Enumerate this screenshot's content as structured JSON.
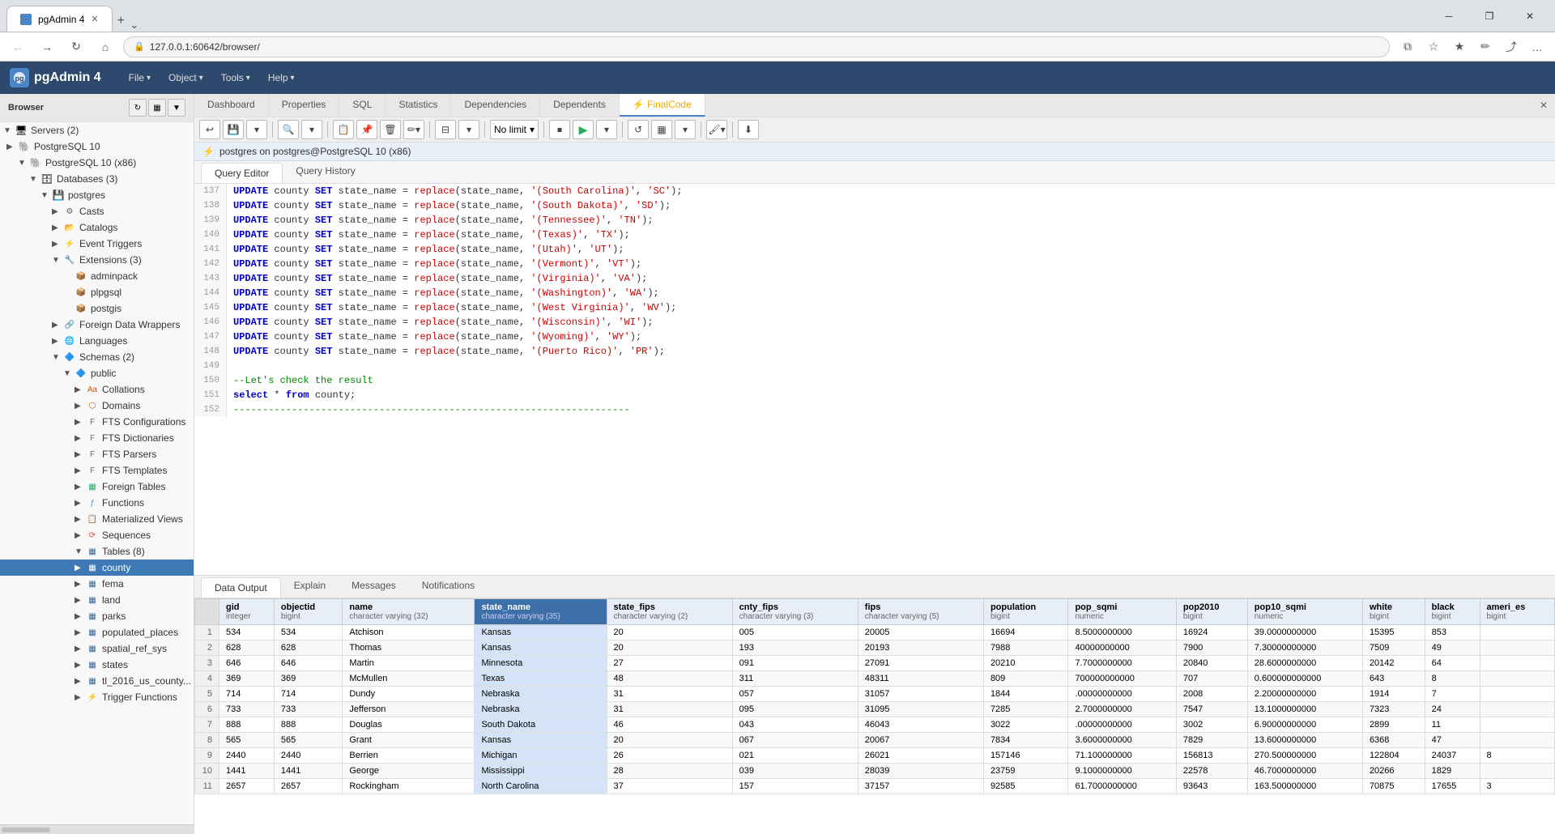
{
  "browser": {
    "tab_label": "pgAdmin 4",
    "url": "127.0.0.1:60642/browser/",
    "url_full": "127.0.0.1:60642/browser/"
  },
  "pgadmin": {
    "title": "pgAdmin 4",
    "menus": [
      "File",
      "Object",
      "Tools",
      "Help"
    ],
    "server_connection": "postgres on postgres@PostgreSQL 10 (x86)"
  },
  "sidebar": {
    "title": "Browser",
    "tree": [
      {
        "id": "servers",
        "label": "Servers (2)",
        "indent": 0,
        "expanded": true,
        "icon": "server"
      },
      {
        "id": "pg10",
        "label": "PostgreSQL 10",
        "indent": 1,
        "expanded": true,
        "icon": "pg"
      },
      {
        "id": "pg10x86",
        "label": "PostgreSQL 10 (x86)",
        "indent": 2,
        "expanded": true,
        "icon": "pg"
      },
      {
        "id": "databases",
        "label": "Databases (3)",
        "indent": 3,
        "expanded": true,
        "icon": "db"
      },
      {
        "id": "postgres",
        "label": "postgres",
        "indent": 4,
        "expanded": true,
        "icon": "db2"
      },
      {
        "id": "casts",
        "label": "Casts",
        "indent": 5,
        "expanded": false,
        "icon": "cast"
      },
      {
        "id": "catalogs",
        "label": "Catalogs",
        "indent": 5,
        "expanded": false,
        "icon": "catalog"
      },
      {
        "id": "event_triggers",
        "label": "Event Triggers",
        "indent": 5,
        "expanded": false,
        "icon": "trigger"
      },
      {
        "id": "extensions",
        "label": "Extensions (3)",
        "indent": 5,
        "expanded": true,
        "icon": "ext"
      },
      {
        "id": "adminpack",
        "label": "adminpack",
        "indent": 6,
        "expanded": false,
        "icon": "ext2"
      },
      {
        "id": "plpgsql",
        "label": "plpgsql",
        "indent": 6,
        "expanded": false,
        "icon": "ext2"
      },
      {
        "id": "postgis",
        "label": "postgis",
        "indent": 6,
        "expanded": false,
        "icon": "ext2"
      },
      {
        "id": "foreign_data",
        "label": "Foreign Data Wrappers",
        "indent": 5,
        "expanded": false,
        "icon": "fdw"
      },
      {
        "id": "languages",
        "label": "Languages",
        "indent": 5,
        "expanded": false,
        "icon": "lang"
      },
      {
        "id": "schemas",
        "label": "Schemas (2)",
        "indent": 5,
        "expanded": true,
        "icon": "schema"
      },
      {
        "id": "public",
        "label": "public",
        "indent": 6,
        "expanded": true,
        "icon": "schema2"
      },
      {
        "id": "collations",
        "label": "Collations",
        "indent": 7,
        "expanded": false,
        "icon": "coll"
      },
      {
        "id": "domains",
        "label": "Domains",
        "indent": 7,
        "expanded": false,
        "icon": "domain"
      },
      {
        "id": "fts_config",
        "label": "FTS Configurations",
        "indent": 7,
        "expanded": false,
        "icon": "fts"
      },
      {
        "id": "fts_dict",
        "label": "FTS Dictionaries",
        "indent": 7,
        "expanded": false,
        "icon": "fts"
      },
      {
        "id": "fts_parsers",
        "label": "FTS Parsers",
        "indent": 7,
        "expanded": false,
        "icon": "fts"
      },
      {
        "id": "fts_templates",
        "label": "FTS Templates",
        "indent": 7,
        "expanded": false,
        "icon": "fts"
      },
      {
        "id": "foreign_tables",
        "label": "Foreign Tables",
        "indent": 7,
        "expanded": false,
        "icon": "ftable"
      },
      {
        "id": "functions",
        "label": "Functions",
        "indent": 7,
        "expanded": false,
        "icon": "func"
      },
      {
        "id": "mat_views",
        "label": "Materialized Views",
        "indent": 7,
        "expanded": false,
        "icon": "matview"
      },
      {
        "id": "sequences",
        "label": "Sequences",
        "indent": 7,
        "expanded": false,
        "icon": "seq"
      },
      {
        "id": "tables",
        "label": "Tables (8)",
        "indent": 7,
        "expanded": true,
        "icon": "tables"
      },
      {
        "id": "county",
        "label": "county",
        "indent": 8,
        "expanded": false,
        "icon": "table",
        "selected": true
      },
      {
        "id": "fema",
        "label": "fema",
        "indent": 8,
        "expanded": false,
        "icon": "table"
      },
      {
        "id": "land",
        "label": "land",
        "indent": 8,
        "expanded": false,
        "icon": "table"
      },
      {
        "id": "parks",
        "label": "parks",
        "indent": 8,
        "expanded": false,
        "icon": "table"
      },
      {
        "id": "populated_places",
        "label": "populated_places",
        "indent": 8,
        "expanded": false,
        "icon": "table"
      },
      {
        "id": "spatial_ref_sys",
        "label": "spatial_ref_sys",
        "indent": 8,
        "expanded": false,
        "icon": "table"
      },
      {
        "id": "states",
        "label": "states",
        "indent": 8,
        "expanded": false,
        "icon": "table"
      },
      {
        "id": "tl2016_us_county",
        "label": "tl_2016_us_county...",
        "indent": 8,
        "expanded": false,
        "icon": "table"
      },
      {
        "id": "trigger_functions",
        "label": "Trigger Functions",
        "indent": 7,
        "expanded": false,
        "icon": "trigfunc"
      }
    ]
  },
  "panel_tabs": [
    "Dashboard",
    "Properties",
    "SQL",
    "Statistics",
    "Dependencies",
    "Dependents",
    "FinalCode"
  ],
  "active_tab": "FinalCode",
  "query_tabs": [
    "Query Editor",
    "Query History"
  ],
  "active_query_tab": "Query Editor",
  "results_tabs": [
    "Data Output",
    "Explain",
    "Messages",
    "Notifications"
  ],
  "active_results_tab": "Data Output",
  "no_limit": "No limit",
  "code_lines": [
    {
      "num": 137,
      "content": "UPDATE county SET state_name = replace(state_name, '(South Carolina)', 'SC');"
    },
    {
      "num": 138,
      "content": "UPDATE county SET state_name = replace(state_name, '(South Dakota)', 'SD');"
    },
    {
      "num": 139,
      "content": "UPDATE county SET state_name = replace(state_name, '(Tennessee)', 'TN');"
    },
    {
      "num": 140,
      "content": "UPDATE county SET state_name = replace(state_name, '(Texas)', 'TX');"
    },
    {
      "num": 141,
      "content": "UPDATE county SET state_name = replace(state_name, '(Utah)', 'UT');"
    },
    {
      "num": 142,
      "content": "UPDATE county SET state_name = replace(state_name, '(Vermont)', 'VT');"
    },
    {
      "num": 143,
      "content": "UPDATE county SET state_name = replace(state_name, '(Virginia)', 'VA');"
    },
    {
      "num": 144,
      "content": "UPDATE county SET state_name = replace(state_name, '(Washington)', 'WA');"
    },
    {
      "num": 145,
      "content": "UPDATE county SET state_name = replace(state_name, '(West Virginia)', 'WV');"
    },
    {
      "num": 146,
      "content": "UPDATE county SET state_name = replace(state_name, '(Wisconsin)', 'WI');"
    },
    {
      "num": 147,
      "content": "UPDATE county SET state_name = replace(state_name, '(Wyoming)', 'WY');"
    },
    {
      "num": 148,
      "content": "UPDATE county SET state_name = replace(state_name, '(Puerto Rico)', 'PR');"
    },
    {
      "num": 149,
      "content": ""
    },
    {
      "num": 150,
      "content": "--Let's check the result"
    },
    {
      "num": 151,
      "content": "select * from county;"
    },
    {
      "num": 152,
      "content": "--------------------------------------------------------------------"
    }
  ],
  "table_columns": [
    {
      "name": "gid",
      "type": "integer"
    },
    {
      "name": "objectid",
      "type": "bigint"
    },
    {
      "name": "name",
      "type": "character varying (32)"
    },
    {
      "name": "state_name",
      "type": "character varying (35)",
      "highlighted": true
    },
    {
      "name": "state_fips",
      "type": "character varying (2)"
    },
    {
      "name": "cnty_fips",
      "type": "character varying (3)"
    },
    {
      "name": "fips",
      "type": "character varying (5)"
    },
    {
      "name": "population",
      "type": "bigint"
    },
    {
      "name": "pop_sqmi",
      "type": "numeric"
    },
    {
      "name": "pop2010",
      "type": "bigint"
    },
    {
      "name": "pop10_sqmi",
      "type": "numeric"
    },
    {
      "name": "white",
      "type": "bigint"
    },
    {
      "name": "black",
      "type": "bigint"
    },
    {
      "name": "ameri_es",
      "type": "bigint"
    }
  ],
  "table_rows": [
    {
      "row": 1,
      "gid": 534,
      "objectid": 534,
      "name": "Atchison",
      "state_name": "Kansas",
      "state_fips": "20",
      "cnty_fips": "005",
      "fips": "20005",
      "population": 16694,
      "pop_sqmi": "8.5000000000",
      "pop2010": 16924,
      "pop10_sqmi": "39.0000000000",
      "white": 15395,
      "black": 853,
      "ameri_es": ""
    },
    {
      "row": 2,
      "gid": 628,
      "objectid": 628,
      "name": "Thomas",
      "state_name": "Kansas",
      "state_fips": "20",
      "cnty_fips": "193",
      "fips": "20193",
      "population": 7988,
      "pop_sqmi": "40000000000",
      "pop2010": 7900,
      "pop10_sqmi": "7.30000000000",
      "white": 7509,
      "black": 49,
      "ameri_es": ""
    },
    {
      "row": 3,
      "gid": 646,
      "objectid": 646,
      "name": "Martin",
      "state_name": "Minnesota",
      "state_fips": "27",
      "cnty_fips": "091",
      "fips": "27091",
      "population": 20210,
      "pop_sqmi": "7.7000000000",
      "pop2010": 20840,
      "pop10_sqmi": "28.6000000000",
      "white": 20142,
      "black": 64,
      "ameri_es": ""
    },
    {
      "row": 4,
      "gid": 369,
      "objectid": 369,
      "name": "McMullen",
      "state_name": "Texas",
      "state_fips": "48",
      "cnty_fips": "311",
      "fips": "48311",
      "population": 809,
      "pop_sqmi": "700000000000",
      "pop2010": 707,
      "pop10_sqmi": "0.600000000000",
      "white": 643,
      "black": 8,
      "ameri_es": ""
    },
    {
      "row": 5,
      "gid": 714,
      "objectid": 714,
      "name": "Dundy",
      "state_name": "Nebraska",
      "state_fips": "31",
      "cnty_fips": "057",
      "fips": "31057",
      "population": 1844,
      "pop_sqmi": ".00000000000",
      "pop2010": 2008,
      "pop10_sqmi": "2.20000000000",
      "white": 1914,
      "black": 7,
      "ameri_es": ""
    },
    {
      "row": 6,
      "gid": 733,
      "objectid": 733,
      "name": "Jefferson",
      "state_name": "Nebraska",
      "state_fips": "31",
      "cnty_fips": "095",
      "fips": "31095",
      "population": 7285,
      "pop_sqmi": "2.7000000000",
      "pop2010": 7547,
      "pop10_sqmi": "13.1000000000",
      "white": 7323,
      "black": 24,
      "ameri_es": ""
    },
    {
      "row": 7,
      "gid": 888,
      "objectid": 888,
      "name": "Douglas",
      "state_name": "South Dakota",
      "state_fips": "46",
      "cnty_fips": "043",
      "fips": "46043",
      "population": 3022,
      "pop_sqmi": ".00000000000",
      "pop2010": 3002,
      "pop10_sqmi": "6.90000000000",
      "white": 2899,
      "black": 11,
      "ameri_es": ""
    },
    {
      "row": 8,
      "gid": 565,
      "objectid": 565,
      "name": "Grant",
      "state_name": "Kansas",
      "state_fips": "20",
      "cnty_fips": "067",
      "fips": "20067",
      "population": 7834,
      "pop_sqmi": "3.6000000000",
      "pop2010": 7829,
      "pop10_sqmi": "13.6000000000",
      "white": 6368,
      "black": 47,
      "ameri_es": ""
    },
    {
      "row": 9,
      "gid": 2440,
      "objectid": 2440,
      "name": "Berrien",
      "state_name": "Michigan",
      "state_fips": "26",
      "cnty_fips": "021",
      "fips": "26021",
      "population": 157146,
      "pop_sqmi": "71.100000000",
      "pop2010": 156813,
      "pop10_sqmi": "270.500000000",
      "white": 122804,
      "black": 24037,
      "ameri_es": "8"
    },
    {
      "row": 10,
      "gid": 1441,
      "objectid": 1441,
      "name": "George",
      "state_name": "Mississippi",
      "state_fips": "28",
      "cnty_fips": "039",
      "fips": "28039",
      "population": 23759,
      "pop_sqmi": "9.1000000000",
      "pop2010": 22578,
      "pop10_sqmi": "46.7000000000",
      "white": 20266,
      "black": 1829,
      "ameri_es": ""
    },
    {
      "row": 11,
      "gid": 2657,
      "objectid": 2657,
      "name": "Rockingham",
      "state_name": "North Carolina",
      "state_fips": "37",
      "cnty_fips": "157",
      "fips": "37157",
      "population": 92585,
      "pop_sqmi": "61.7000000000",
      "pop2010": 93643,
      "pop10_sqmi": "163.500000000",
      "white": 70875,
      "black": 17655,
      "ameri_es": "3"
    }
  ]
}
